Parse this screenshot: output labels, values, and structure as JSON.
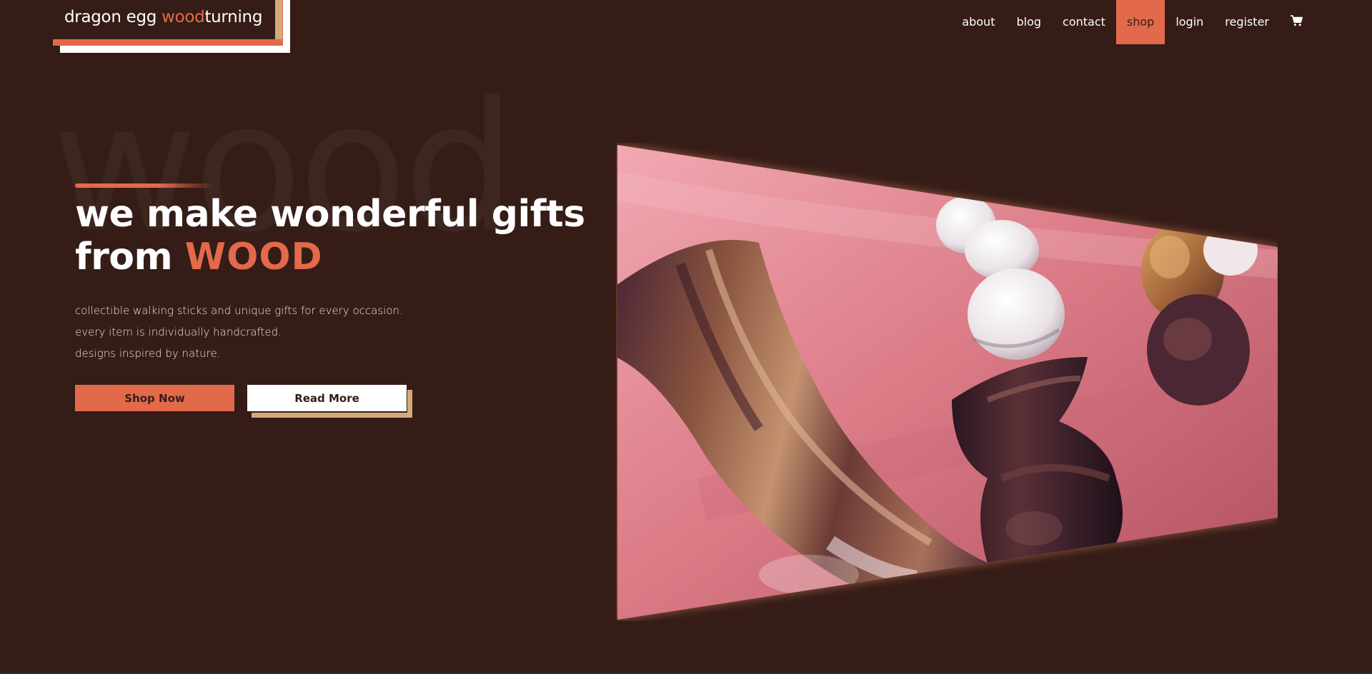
{
  "logo": {
    "part1": "dragon egg ",
    "accent": "wood",
    "part2": "turning"
  },
  "nav": {
    "items": [
      {
        "label": "about"
      },
      {
        "label": "blog"
      },
      {
        "label": "contact"
      },
      {
        "label": "shop",
        "active": true
      },
      {
        "label": "login"
      },
      {
        "label": "register"
      }
    ],
    "cart_icon": "shopping-cart-icon"
  },
  "watermark": "wood",
  "hero": {
    "headline_line1": "we make wonderful gifts",
    "headline_line2_prefix": "from ",
    "headline_accent": "WOOD",
    "description": [
      "collectible walking sticks and unique gifts for every occasion.",
      "every item is individually handcrafted.",
      "designs inspired by nature."
    ],
    "primary_button": "Shop Now",
    "secondary_button": "Read More"
  },
  "colors": {
    "background": "#351c17",
    "accent": "#e26a4b",
    "tan": "#d2aa79",
    "white": "#ffffff"
  }
}
